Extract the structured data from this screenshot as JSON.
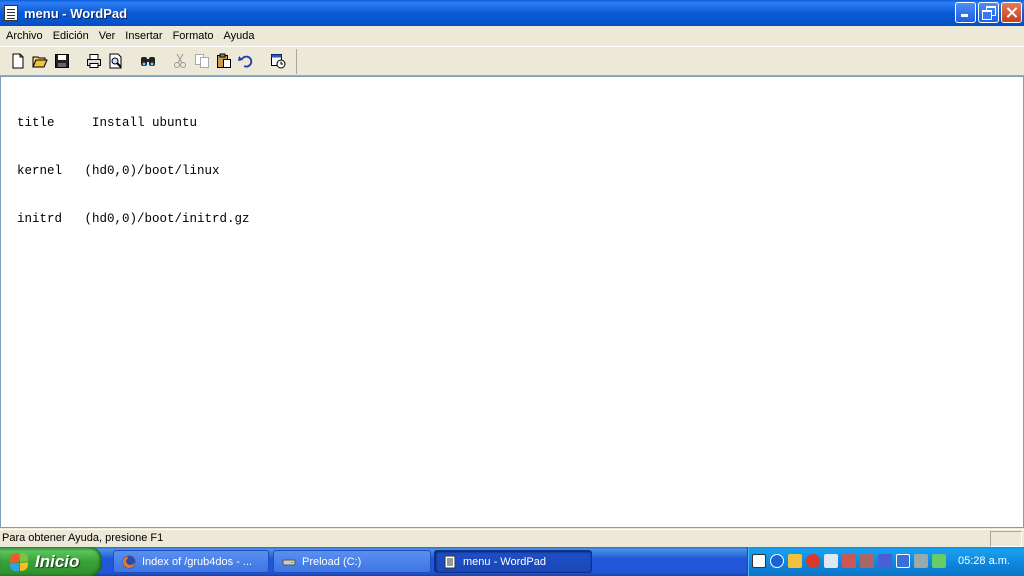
{
  "window": {
    "title": "menu - WordPad",
    "icon": "wordpad-doc-icon"
  },
  "caption_buttons": [
    "minimize-icon",
    "restore-icon",
    "close-icon"
  ],
  "menu": {
    "items": [
      "Archivo",
      "Edición",
      "Ver",
      "Insertar",
      "Formato",
      "Ayuda"
    ]
  },
  "toolbar": {
    "buttons": [
      "new-icon",
      "open-icon",
      "save-icon",
      "print-icon",
      "print-preview-icon",
      "find-icon",
      "cut-icon",
      "copy-icon",
      "paste-icon",
      "undo-icon",
      "date-time-icon"
    ]
  },
  "document": {
    "lines": [
      "title     Install ubuntu",
      "kernel   (hd0,0)/boot/linux",
      "initrd   (hd0,0)/boot/initrd.gz"
    ]
  },
  "statusbar": {
    "text": "Para obtener Ayuda, presione F1"
  },
  "taskbar": {
    "start_label": "Inicio",
    "tasks": [
      {
        "label": "Index of /grub4dos - ...",
        "icon": "firefox-icon",
        "active": false
      },
      {
        "label": "Preload (C:)",
        "icon": "drive-icon",
        "active": false
      },
      {
        "label": "menu - WordPad",
        "icon": "wordpad-icon",
        "active": true
      }
    ],
    "clock": "05:28 a.m."
  },
  "colors": {
    "titlebar": "#0b5bd6",
    "taskbar": "#2157d7",
    "start": "#37a337",
    "tray": "#0d85db",
    "chrome": "#ece9d8"
  }
}
